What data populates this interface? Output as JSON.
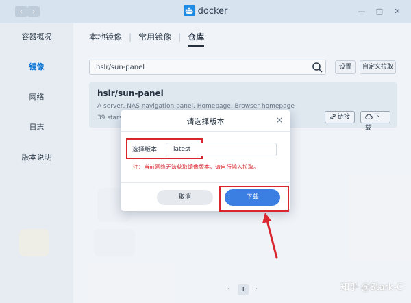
{
  "window": {
    "title": "docker"
  },
  "sidebar": {
    "items": [
      {
        "label": "容器概况"
      },
      {
        "label": "镜像"
      },
      {
        "label": "网络"
      },
      {
        "label": "日志"
      },
      {
        "label": "版本说明"
      }
    ],
    "active_index": 1
  },
  "tabs": [
    {
      "label": "本地镜像"
    },
    {
      "label": "常用镜像"
    },
    {
      "label": "仓库"
    }
  ],
  "search": {
    "value": "hslr/sun-panel",
    "settings_label": "设置",
    "custom_pull_label": "自定义拉取"
  },
  "result": {
    "title": "hslr/sun-panel",
    "description": "A server, NAS navigation panel, Homepage, Browser homepage",
    "stars": "39 stars",
    "link_label": "链接",
    "download_label": "下载"
  },
  "pagination": {
    "prev": "‹",
    "current": "1",
    "next": "›"
  },
  "dialog": {
    "title": "请选择版本",
    "close": "×",
    "version_label": "选择版本:",
    "version_value": "latest",
    "warning": "注：当前网络无法获取镜像版本，请自行输入拉取。",
    "cancel_label": "取消",
    "download_label": "下载"
  },
  "watermark": "知乎 @Stark-C",
  "colors": {
    "accent_blue": "#3c7fe3",
    "sidebar_active": "#0a74d8",
    "highlight_red": "#d9262e",
    "titlebar": "#dde9f5"
  },
  "icons": {
    "nav_back": "‹",
    "nav_forward": "›",
    "minimize": "—",
    "maximize": "□",
    "close": "✕"
  }
}
